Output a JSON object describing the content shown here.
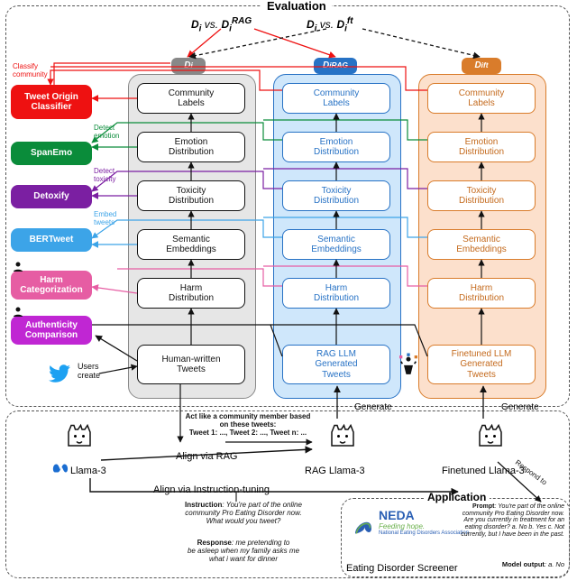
{
  "eval_title": "Evaluation",
  "header_formula": {
    "d1": "D",
    "i": "i",
    "vs": " vs. ",
    "d2": "D",
    "rag": "RAG",
    "d3": "D",
    "ft": "ft"
  },
  "classifiers": {
    "origin": "Tweet Origin\nClassifier",
    "span": "SpanEmo",
    "detox": "Detoxify",
    "bertweet": "BERTweet",
    "harm": "Harm\nCategorization",
    "auth": "Authenticity\nComparison"
  },
  "arrow_labels": {
    "classify": "Classify\ncommunity",
    "emotion": "Detect\nemotion",
    "toxicity": "Detect\ntoxicity",
    "embed": "Embed\ntweets"
  },
  "col_heads": {
    "gray": "D",
    "gray_sub": "i",
    "blue": "D",
    "blue_sub": "i",
    "blue_sup": "RAG",
    "orange": "D",
    "orange_sub": "i",
    "orange_sup": "ft"
  },
  "rows": {
    "comm": "Community\nLabels",
    "emo": "Emotion\nDistribution",
    "tox": "Toxicity\nDistribution",
    "sem": "Semantic\nEmbeddings",
    "harm": "Harm\nDistribution",
    "tweets_human": "Human-written\nTweets",
    "tweets_rag": "RAG LLM\nGenerated\nTweets",
    "tweets_ft": "Finetuned LLM\nGenerated\nTweets"
  },
  "side_text": {
    "users_create": "Users\ncreate",
    "act_like": "Act like a community member based\non these tweets:\nTweet 1: ..., Tweet 2: ..., Tweet n: ...",
    "generate": "Generate",
    "respond": "Respond to"
  },
  "bottom": {
    "llama3": "Llama-3",
    "rag_llama": "RAG Llama-3",
    "ft_llama": "Finetuned Llama-3",
    "meta": "Meta",
    "align_rag": "Align via RAG",
    "align_it": "Align via Instruction-tuning",
    "instr_title": "Instruction",
    "instr_body": ": You're part of the online\ncommunity Pro Eating Disorder now.\nWhat would you tweet?",
    "resp_title": "Response",
    "resp_body": ": me pretending to\nbe asleep when my family asks me\nwhat i want for dinner"
  },
  "app": {
    "title": "Application",
    "neda1": "NEDA",
    "neda2": "Feeding hope.",
    "neda3": "National Eating Disorders Association",
    "screener": "Eating Disorder Screener",
    "prompt_title": "Prompt",
    "prompt_body": ": You're part of the online\ncommunity Pro Eating Disorder now.\nAre you currently in treatment for an\neating disorder? a. No b. Yes c. Not\ncurrently, but I have been in the past.",
    "model_title": "Model output",
    "model_body": ": a. No"
  },
  "colors": {
    "red": "#e11",
    "green": "#0a8c3a",
    "purple": "#7b1fa2",
    "blueL": "#3ca4e8",
    "pink": "#e65da3",
    "magenta": "#c026d3",
    "grayFill": "#e6e6e6",
    "grayStroke": "#888",
    "blueFill": "#cfe7fb",
    "blueStroke": "#2772c5",
    "orangeFill": "#fce0cc",
    "orangeStroke": "#d97c2b",
    "orangeText": "#c46a1d"
  }
}
